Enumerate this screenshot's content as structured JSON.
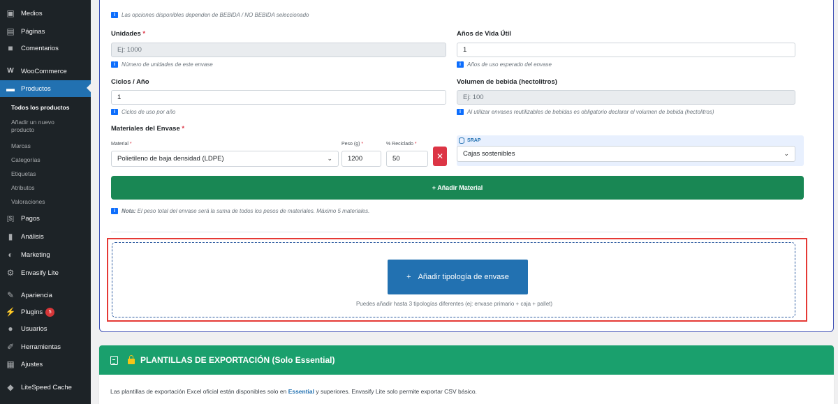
{
  "sidebar": {
    "menu": [
      {
        "label": "Medios",
        "icon": "media-icon"
      },
      {
        "label": "Páginas",
        "icon": "pages-icon"
      },
      {
        "label": "Comentarios",
        "icon": "comments-icon"
      },
      {
        "label": "WooCommerce",
        "icon": "woocommerce-icon"
      },
      {
        "label": "Productos",
        "icon": "products-icon",
        "active": true
      }
    ],
    "submenu": [
      "Todos los productos",
      "Añadir un nuevo producto",
      "Marcas",
      "Categorías",
      "Etiquetas",
      "Atributos",
      "Valoraciones"
    ],
    "menu2": [
      {
        "label": "Pagos",
        "icon": "payments-icon"
      },
      {
        "label": "Análisis",
        "icon": "analytics-icon"
      },
      {
        "label": "Marketing",
        "icon": "marketing-icon"
      },
      {
        "label": "Envasify Lite",
        "icon": "envasify-icon"
      },
      {
        "label": "Apariencia",
        "icon": "appearance-icon"
      },
      {
        "label": "Plugins",
        "icon": "plugins-icon",
        "badge": "5"
      },
      {
        "label": "Usuarios",
        "icon": "users-icon"
      },
      {
        "label": "Herramientas",
        "icon": "tools-icon"
      },
      {
        "label": "Ajustes",
        "icon": "settings-icon"
      },
      {
        "label": "LiteSpeed Cache",
        "icon": "litespeed-icon"
      }
    ]
  },
  "form": {
    "top_hint": "Las opciones disponibles dependen de BEBIDA / NO BEBIDA seleccionado",
    "unidades": {
      "label": "Unidades",
      "required": "*",
      "placeholder": "Ej: 1000",
      "help": "Número de unidades de este envase"
    },
    "anos_vida": {
      "label": "Años de Vida Útil",
      "value": "1",
      "help": "Años de uso esperado del envase"
    },
    "ciclos": {
      "label": "Ciclos / Año",
      "value": "1",
      "help": "Ciclos de uso por año"
    },
    "volumen": {
      "label": "Volumen de bebida (hectolitros)",
      "placeholder": "Ej: 100",
      "help": "Al utilizar envases reutilizables de bebidas es obligatorio declarar el volumen de bebida (hectolitros)"
    },
    "materiales_title": "Materiales del Envase",
    "materiales_required": "*",
    "material_row": {
      "material_label": "Material",
      "material_value": "Polietileno de baja densidad (LDPE)",
      "peso_label": "Peso (g)",
      "peso_value": "1200",
      "reciclado_label": "% Reciclado",
      "reciclado_value": "50",
      "remove_symbol": "✕",
      "srap_label": "SRAP",
      "srap_value": "Cajas sostenibles"
    },
    "add_material": "+ Añadir Material",
    "note_bold": "Nota:",
    "note_text": " El peso total del envase será la suma de todos los pesos de materiales. Máximo 5 materiales.",
    "add_typology_plus": "+",
    "add_typology": "Añadir tipología de envase",
    "typology_help": "Puedes añadir hasta 3 tipologías diferentes (ej: envase primario + caja + pallet)"
  },
  "templates": {
    "title": "PLANTILLAS DE EXPORTACIÓN (Solo Essential)",
    "text_before": "Las plantillas de exportación Excel oficial están disponibles solo en ",
    "plan": "Essential",
    "text_after": " y superiores. Envasify Lite solo permite exportar CSV básico."
  },
  "colors": {
    "primary": "#2271b1",
    "success": "#198754",
    "danger": "#dc3545",
    "header_green": "#1aa06d",
    "sidebar": "#1d2327"
  }
}
